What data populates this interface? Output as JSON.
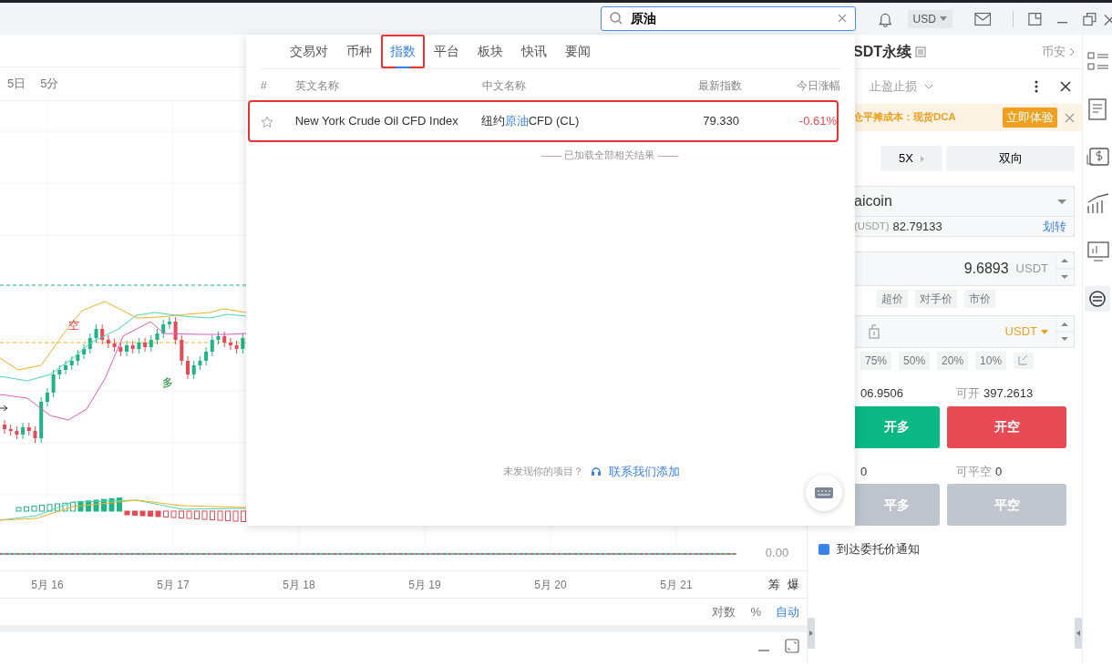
{
  "top_bar": {
    "search": {
      "value": "原油"
    },
    "currency": "USD"
  },
  "chart_toolbar": {
    "periods": [
      "5日",
      "5分"
    ]
  },
  "chart": {
    "markers": [
      {
        "kind": "short",
        "text": "空"
      },
      {
        "kind": "long",
        "text": "多"
      }
    ],
    "y_label": "0.00",
    "x_labels": [
      "5月 16",
      "5月 17",
      "5月 18",
      "5月 19",
      "5月 20",
      "5月 21"
    ],
    "side_labels": [
      "筹",
      "爆"
    ]
  },
  "scale_options": [
    {
      "label": "对数",
      "selected": false
    },
    {
      "label": "%",
      "selected": false
    },
    {
      "label": "自动",
      "selected": true
    }
  ],
  "search_dropdown": {
    "tabs": [
      {
        "label": "交易对",
        "selected": false,
        "annotated": false
      },
      {
        "label": "币种",
        "selected": false,
        "annotated": false
      },
      {
        "label": "指数",
        "selected": true,
        "annotated": true
      },
      {
        "label": "平台",
        "selected": false,
        "annotated": false
      },
      {
        "label": "板块",
        "selected": false,
        "annotated": false
      },
      {
        "label": "快讯",
        "selected": false,
        "annotated": false
      },
      {
        "label": "要闻",
        "selected": false,
        "annotated": false
      }
    ],
    "columns": [
      "#",
      "英文名称",
      "中文名称",
      "最新指数",
      "今日涨幅"
    ],
    "results": [
      {
        "starred": false,
        "english_name": "New York Crude Oil CFD Index",
        "chinese_name_parts": [
          {
            "text": "纽约",
            "highlight": false
          },
          {
            "text": "原油",
            "highlight": true
          },
          {
            "text": "CFD (CL)",
            "highlight": false
          }
        ],
        "latest": "79.330",
        "change": "-0.61%",
        "annotated": true
      }
    ],
    "end_note": "—— 已加载全部相关结果 ——",
    "missing_prompt": "未发现你的项目？",
    "contact_link": "联系我们添加"
  },
  "order_panel": {
    "title": "SDT永续",
    "exchange": "币安",
    "mode": "止盈止损",
    "banner": {
      "text": "仓平摊成本：现货DCA",
      "action": "立即体验"
    },
    "leverage": "5X",
    "position_mode": "双向",
    "account": {
      "name": "aicoin",
      "balance_label": "(USDT)",
      "balance": "82.79133",
      "transfer": "划转"
    },
    "price": {
      "value": "9.6893",
      "unit": "USDT"
    },
    "price_types": [
      "超价",
      "对手价",
      "市价"
    ],
    "amount_unit": "USDT",
    "ratios": [
      "75%",
      "50%",
      "20%",
      "10%"
    ],
    "availability": [
      {
        "value": "06.9506"
      },
      {
        "label": "可开",
        "value": "397.2613"
      },
      {
        "value": "0"
      },
      {
        "label": "可平空",
        "value": "0"
      }
    ],
    "buttons": [
      {
        "label": "开多",
        "kind": "long",
        "disabled": false
      },
      {
        "label": "开空",
        "kind": "short",
        "disabled": false
      },
      {
        "label": "平多",
        "kind": "long",
        "disabled": true
      },
      {
        "label": "平空",
        "kind": "short",
        "disabled": true
      }
    ],
    "notify": {
      "label": "到达委托价通知",
      "checked": true
    }
  }
}
